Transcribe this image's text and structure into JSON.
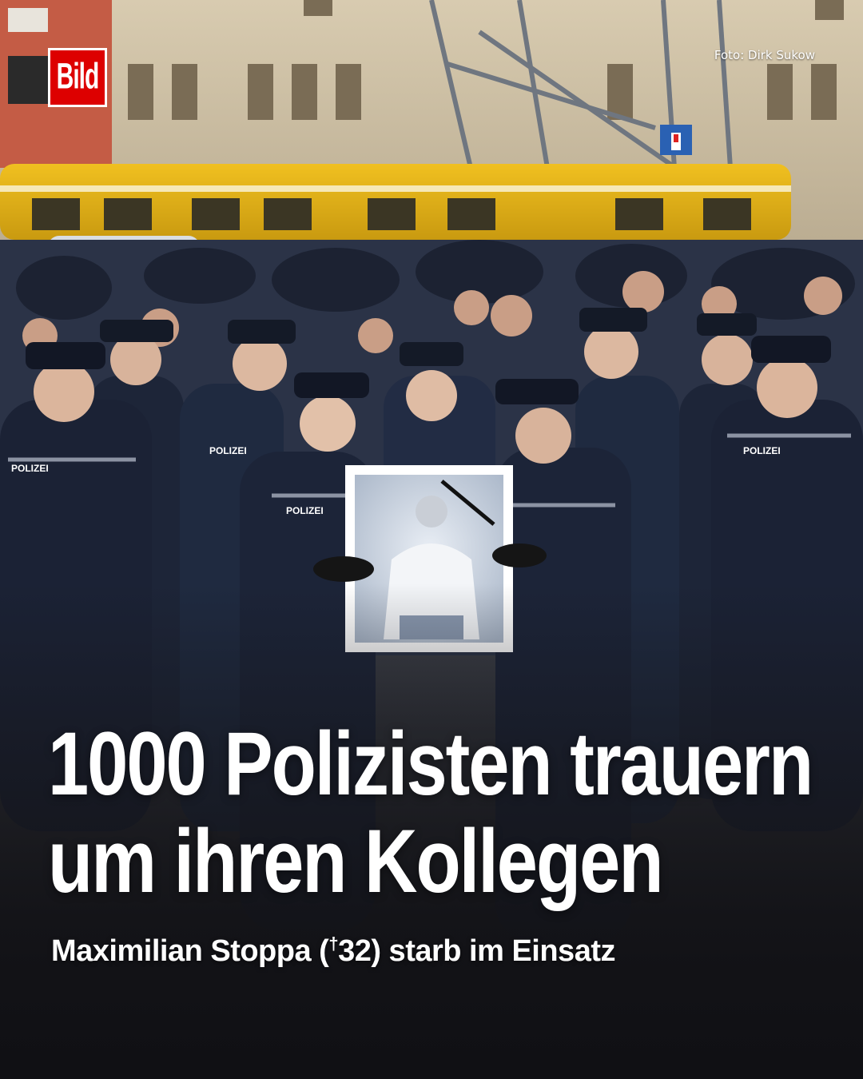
{
  "brand": {
    "logo_text": "Bild",
    "logo_color": "#dd0000"
  },
  "photo_credit": "Foto: Dirk Sukow",
  "headline": {
    "line1": "1000 Polizisten trauern",
    "line2": "um ihren Kollegen"
  },
  "subline": {
    "before": "Maximilian Stoppa (",
    "dagger": "†",
    "after": "32) starb im Einsatz"
  },
  "photo_labels": {
    "uniform_text": "POLIZEI"
  }
}
